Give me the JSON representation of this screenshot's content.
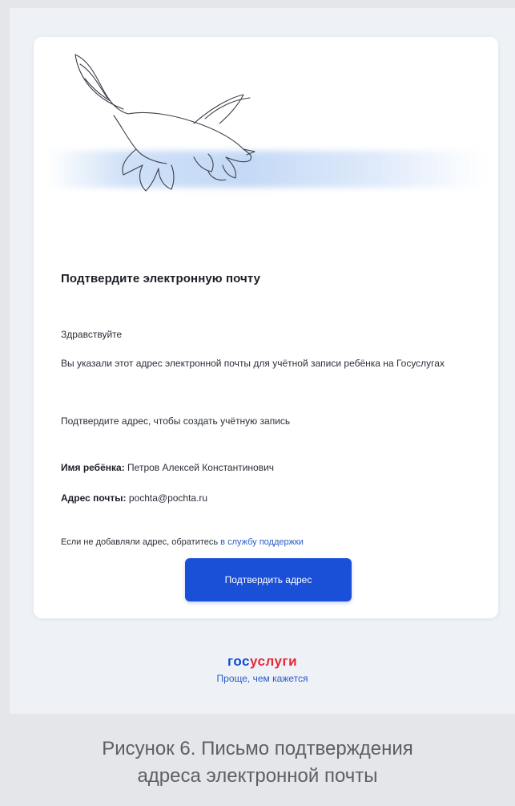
{
  "email": {
    "title": "Подтвердите электронную почту",
    "greeting": "Здравствуйте",
    "lead": "Вы указали этот адрес электронной почты для учётной записи ребёнка на Госуслугах",
    "ask": "Подтвердите адрес, чтобы создать учётную запись",
    "child_label": "Имя ребёнка:",
    "child_value": "Петров Алексей Константинович",
    "email_label": "Адрес почты:",
    "email_value": "pochta@pochta.ru",
    "support_text": "Если не добавляли адрес, обратитесь",
    "support_link": "в службу поддержки",
    "confirm_button": "Подтвердить адрес"
  },
  "footer": {
    "brand_part1": "гос",
    "brand_part2": "услуги",
    "slogan": "Проще, чем кажется"
  },
  "caption": {
    "line1": "Рисунок 6. Письмо подтверждения",
    "line2": "адреса электронной почты"
  },
  "colors": {
    "accent": "#1a4fd8",
    "brand_blue": "#0d4cd3",
    "brand_red": "#e2293b",
    "link": "#2a5cc8"
  },
  "icons": [
    "dove-illustration"
  ]
}
